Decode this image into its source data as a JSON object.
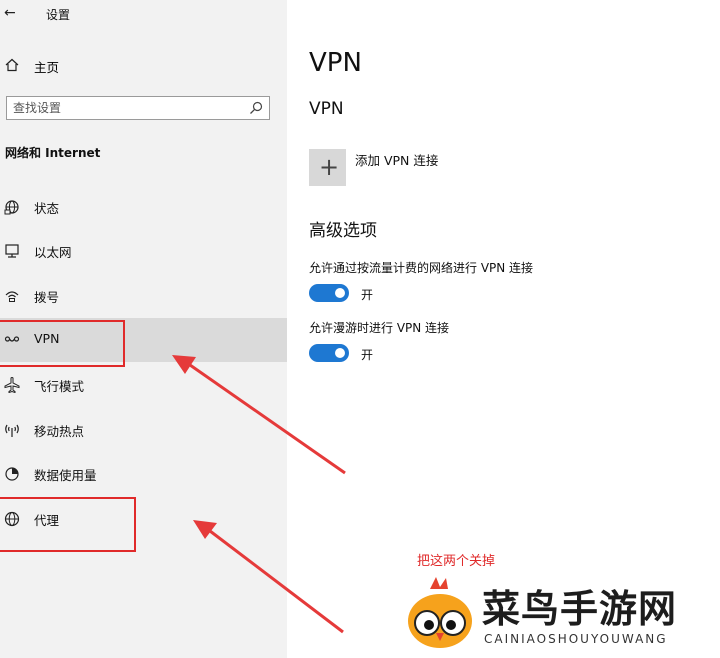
{
  "window": {
    "back_glyph": "←",
    "title": "设置"
  },
  "sidebar": {
    "home_label": "主页",
    "search_placeholder": "查找设置",
    "section_title": "网络和 Internet",
    "items": [
      {
        "label": "状态",
        "icon": "globe-status-icon"
      },
      {
        "label": "以太网",
        "icon": "ethernet-icon"
      },
      {
        "label": "拨号",
        "icon": "dial-up-icon"
      },
      {
        "label": "VPN",
        "icon": "vpn-icon",
        "selected": true
      },
      {
        "label": "飞行模式",
        "icon": "airplane-icon"
      },
      {
        "label": "移动热点",
        "icon": "hotspot-icon"
      },
      {
        "label": "数据使用量",
        "icon": "data-usage-icon"
      },
      {
        "label": "代理",
        "icon": "globe-icon"
      }
    ]
  },
  "main": {
    "page_title": "VPN",
    "vpn_heading": "VPN",
    "add_vpn_label": "添加 VPN 连接",
    "advanced_heading": "高级选项",
    "options": [
      {
        "label": "允许通过按流量计费的网络进行 VPN 连接",
        "state": "开",
        "on": true
      },
      {
        "label": "允许漫游时进行 VPN 连接",
        "state": "开",
        "on": true
      }
    ]
  },
  "annotation": {
    "text": "把这两个关掉",
    "color": "#e02a2a"
  },
  "watermark": {
    "text": "菜鸟手游网",
    "subtext": "CAINIAOSHOUYOUWANG"
  },
  "colors": {
    "accent": "#1e78d2",
    "sidebar_bg": "#f2f2f2",
    "selected_bg": "#dadada"
  }
}
